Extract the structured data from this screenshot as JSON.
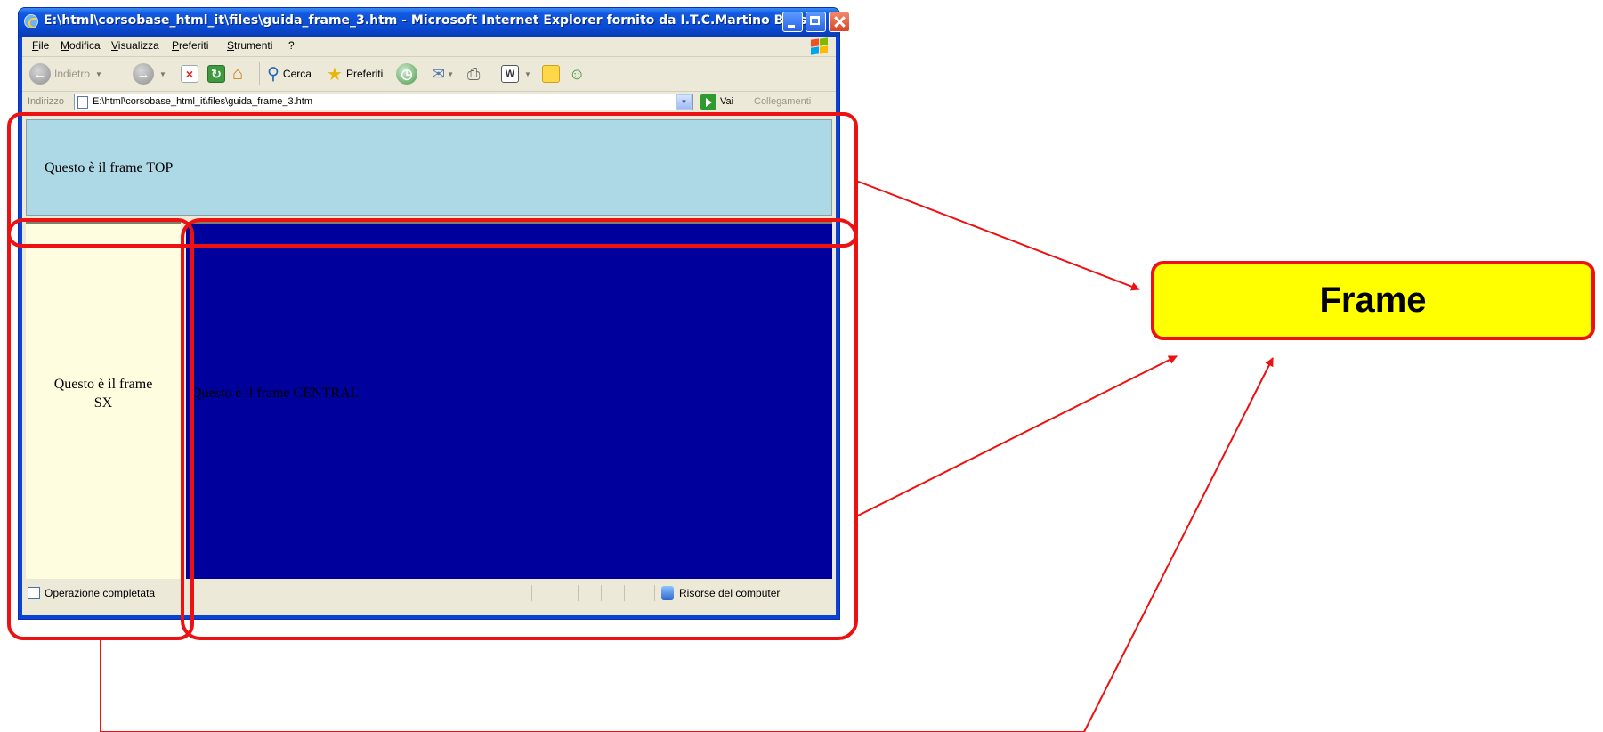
{
  "window": {
    "title": "E:\\html\\corsobase_html_it\\files\\guida_frame_3.htm - Microsoft Internet Explorer fornito da I.T.C.Martino Bassi"
  },
  "menu": {
    "items": [
      "File",
      "Modifica",
      "Visualizza",
      "Preferiti",
      "Strumenti",
      "?"
    ]
  },
  "toolbar": {
    "back_label": "Indietro",
    "search_label": "Cerca",
    "favorites_label": "Preferiti"
  },
  "address": {
    "label": "Indirizzo",
    "url": "E:\\html\\corsobase_html_it\\files\\guida_frame_3.htm",
    "go_label": "Vai",
    "links_label": "Collegamenti"
  },
  "frames": {
    "top_text": "Questo è il frame TOP",
    "sx_text_line1": "Questo è il frame",
    "sx_text_line2": "SX",
    "central_text": "Questo è il frame CENTRAL"
  },
  "status": {
    "text": "Operazione completata",
    "zone": "Risorse del computer"
  },
  "annotation": {
    "label": "Frame",
    "color": "#ee1111",
    "label_bg": "#ffff00"
  }
}
